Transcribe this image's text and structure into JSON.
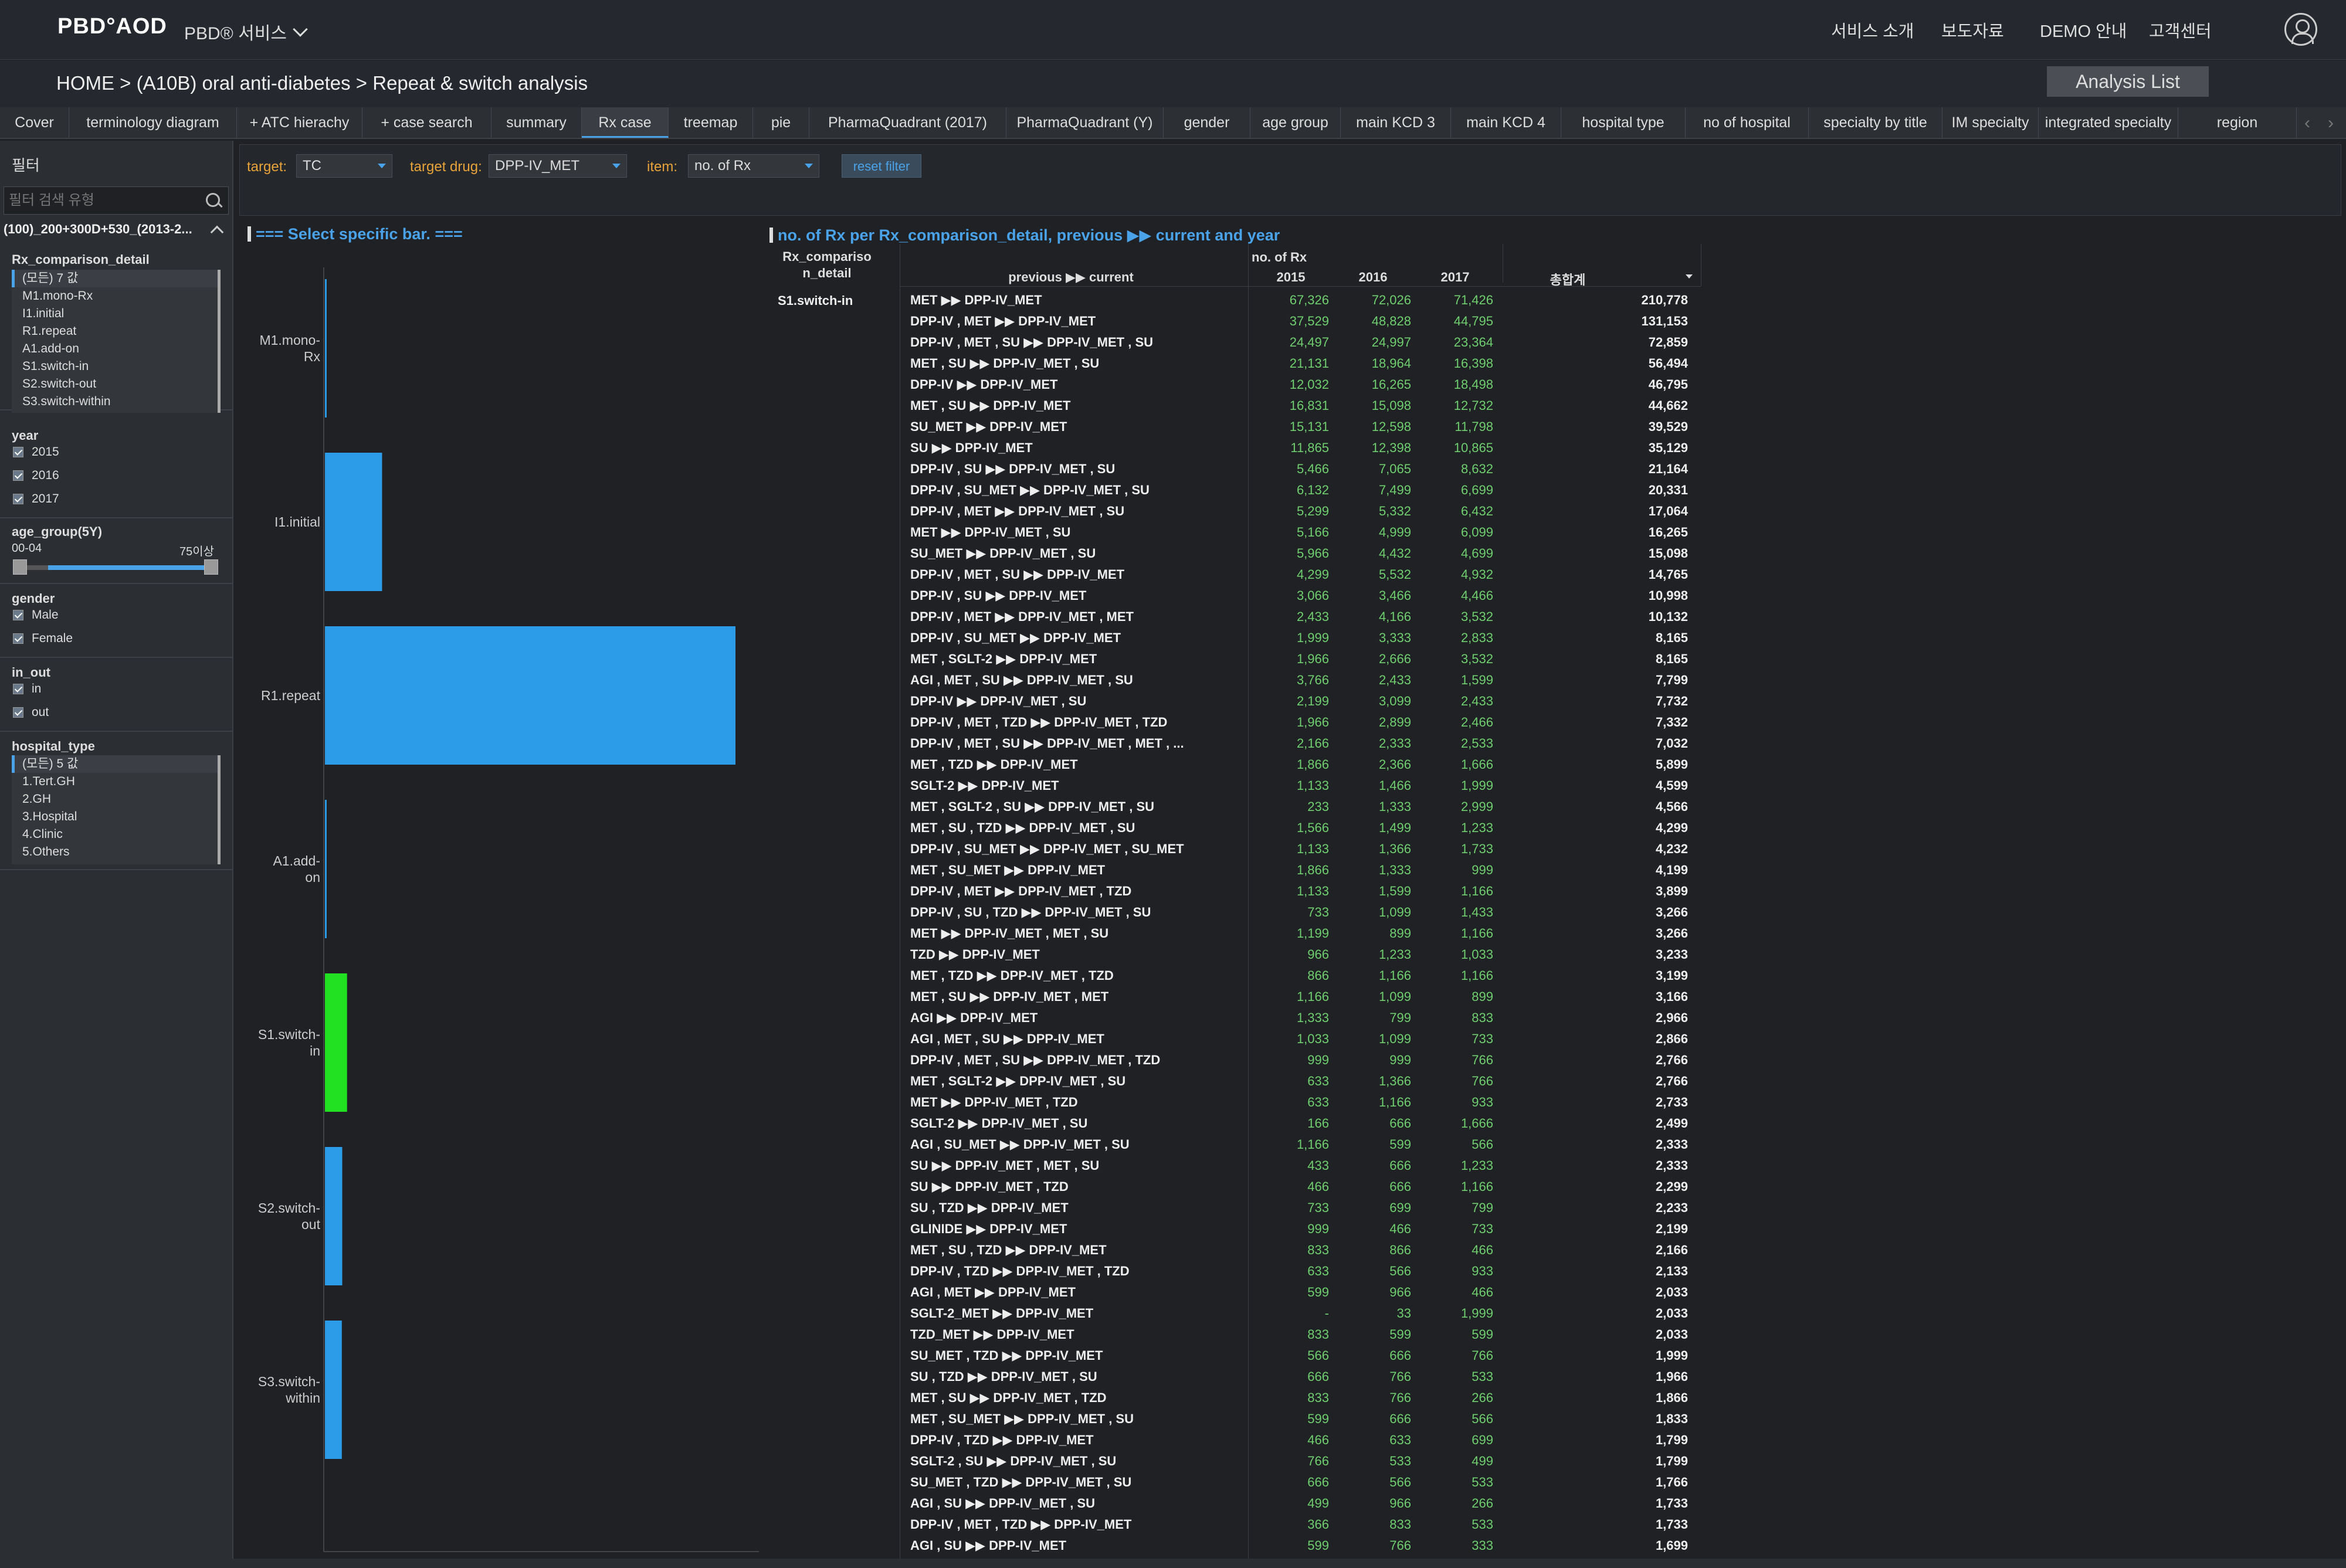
{
  "header": {
    "logo": "PBD°AOD",
    "service_menu": "PBD® 서비스",
    "nav": [
      "서비스 소개",
      "보도자료",
      "DEMO 안내",
      "고객센터"
    ],
    "user_icon": "user-icon"
  },
  "breadcrumb": {
    "text": "HOME >  (A10B) oral anti-diabetes > Repeat & switch analysis",
    "analysis_list": "Analysis List"
  },
  "tabs": [
    "Cover",
    "terminology diagram",
    "+ ATC hierachy",
    "+ case search",
    "summary",
    "Rx case",
    "treemap",
    "pie",
    "PharmaQuadrant (2017)",
    "PharmaQuadrant (Y)",
    "gender",
    "age group",
    "main KCD 3",
    "main KCD 4",
    "hospital type",
    "no of hospital",
    "specialty by title",
    "IM specialty",
    "integrated specialty",
    "region"
  ],
  "active_tab": "Rx case",
  "sidebar": {
    "title": "필터",
    "search_placeholder": "필터 검색 유형",
    "summary": "(100)_200+300D+530_(2013-2...",
    "rx_comparison": {
      "title": "Rx_comparison_detail",
      "items": [
        "(모든) 7 값",
        "M1.mono-Rx",
        "I1.initial",
        "R1.repeat",
        "A1.add-on",
        "S1.switch-in",
        "S2.switch-out",
        "S3.switch-within"
      ]
    },
    "year": {
      "title": "year",
      "items": [
        "2015",
        "2016",
        "2017"
      ]
    },
    "age_group": {
      "title": "age_group(5Y)",
      "min_label": "00-04",
      "max_label": "75이상"
    },
    "gender": {
      "title": "gender",
      "items": [
        "Male",
        "Female"
      ]
    },
    "in_out": {
      "title": "in_out",
      "items": [
        "in",
        "out"
      ]
    },
    "hospital_type": {
      "title": "hospital_type",
      "items": [
        "(모든) 5 값",
        "1.Tert.GH",
        "2.GH",
        "3.Hospital",
        "4.Clinic",
        "5.Others"
      ]
    }
  },
  "filterbar": {
    "target_label": "target:",
    "target_value": "TC",
    "drug_label": "target drug:",
    "drug_value": "DPP-IV_MET",
    "item_label": "item:",
    "item_value": "no. of Rx",
    "reset": "reset filter"
  },
  "chart_title": "=== Select specific bar. ===",
  "table_title": "no. of Rx per Rx_comparison_detail, previous ▶▶ current and year",
  "colors": {
    "accent": "#4aa3e8",
    "bar": "#2c9be8",
    "bar_selected": "#22e022",
    "value_green": "#6fcf6f",
    "label_orange": "#e8a33a"
  },
  "chart_data": {
    "type": "bar",
    "orientation": "horizontal",
    "categories": [
      "M1.mono-Rx",
      "I1.initial",
      "R1.repeat",
      "A1.add-on",
      "S1.switch-in",
      "S2.switch-out",
      "S3.switch-within"
    ],
    "values": [
      1000,
      71000,
      510000,
      500,
      27500,
      21500,
      21000
    ],
    "selected": "S1.switch-in"
  },
  "table": {
    "col_group": "Rx_compariso n_detail",
    "col_prev_curr": "previous ▶▶ current",
    "measure": "no. of Rx",
    "years": [
      "2015",
      "2016",
      "2017"
    ],
    "total_label": "총합계",
    "group_value": "S1.switch-in",
    "rows": [
      [
        "MET ▶▶ DPP-IV_MET",
        "67,326",
        "72,026",
        "71,426",
        "210,778"
      ],
      [
        "DPP-IV , MET ▶▶ DPP-IV_MET",
        "37,529",
        "48,828",
        "44,795",
        "131,153"
      ],
      [
        "DPP-IV , MET , SU ▶▶ DPP-IV_MET , SU",
        "24,497",
        "24,997",
        "23,364",
        "72,859"
      ],
      [
        "MET , SU ▶▶ DPP-IV_MET , SU",
        "21,131",
        "18,964",
        "16,398",
        "56,494"
      ],
      [
        "DPP-IV ▶▶ DPP-IV_MET",
        "12,032",
        "16,265",
        "18,498",
        "46,795"
      ],
      [
        "MET , SU ▶▶ DPP-IV_MET",
        "16,831",
        "15,098",
        "12,732",
        "44,662"
      ],
      [
        "SU_MET ▶▶ DPP-IV_MET",
        "15,131",
        "12,598",
        "11,798",
        "39,529"
      ],
      [
        "SU ▶▶ DPP-IV_MET",
        "11,865",
        "12,398",
        "10,865",
        "35,129"
      ],
      [
        "DPP-IV , SU ▶▶ DPP-IV_MET , SU",
        "5,466",
        "7,065",
        "8,632",
        "21,164"
      ],
      [
        "DPP-IV , SU_MET ▶▶ DPP-IV_MET , SU",
        "6,132",
        "7,499",
        "6,699",
        "20,331"
      ],
      [
        "DPP-IV , MET ▶▶ DPP-IV_MET , SU",
        "5,299",
        "5,332",
        "6,432",
        "17,064"
      ],
      [
        "MET ▶▶ DPP-IV_MET , SU",
        "5,166",
        "4,999",
        "6,099",
        "16,265"
      ],
      [
        "SU_MET ▶▶ DPP-IV_MET , SU",
        "5,966",
        "4,432",
        "4,699",
        "15,098"
      ],
      [
        "DPP-IV , MET , SU ▶▶ DPP-IV_MET",
        "4,299",
        "5,532",
        "4,932",
        "14,765"
      ],
      [
        "DPP-IV , SU ▶▶ DPP-IV_MET",
        "3,066",
        "3,466",
        "4,466",
        "10,998"
      ],
      [
        "DPP-IV , MET ▶▶ DPP-IV_MET , MET",
        "2,433",
        "4,166",
        "3,532",
        "10,132"
      ],
      [
        "DPP-IV , SU_MET ▶▶ DPP-IV_MET",
        "1,999",
        "3,333",
        "2,833",
        "8,165"
      ],
      [
        "MET , SGLT-2 ▶▶ DPP-IV_MET",
        "1,966",
        "2,666",
        "3,532",
        "8,165"
      ],
      [
        "AGI , MET , SU ▶▶ DPP-IV_MET , SU",
        "3,766",
        "2,433",
        "1,599",
        "7,799"
      ],
      [
        "DPP-IV ▶▶ DPP-IV_MET , SU",
        "2,199",
        "3,099",
        "2,433",
        "7,732"
      ],
      [
        "DPP-IV , MET , TZD ▶▶ DPP-IV_MET , TZD",
        "1,966",
        "2,899",
        "2,466",
        "7,332"
      ],
      [
        "DPP-IV , MET , SU ▶▶ DPP-IV_MET , MET , ...",
        "2,166",
        "2,333",
        "2,533",
        "7,032"
      ],
      [
        "MET , TZD ▶▶ DPP-IV_MET",
        "1,866",
        "2,366",
        "1,666",
        "5,899"
      ],
      [
        "SGLT-2 ▶▶ DPP-IV_MET",
        "1,133",
        "1,466",
        "1,999",
        "4,599"
      ],
      [
        "MET , SGLT-2 , SU ▶▶ DPP-IV_MET , SU",
        "233",
        "1,333",
        "2,999",
        "4,566"
      ],
      [
        "MET , SU , TZD ▶▶ DPP-IV_MET , SU",
        "1,566",
        "1,499",
        "1,233",
        "4,299"
      ],
      [
        "DPP-IV , SU_MET ▶▶ DPP-IV_MET , SU_MET",
        "1,133",
        "1,366",
        "1,733",
        "4,232"
      ],
      [
        "MET , SU_MET ▶▶ DPP-IV_MET",
        "1,866",
        "1,333",
        "999",
        "4,199"
      ],
      [
        "DPP-IV , MET ▶▶ DPP-IV_MET , TZD",
        "1,133",
        "1,599",
        "1,166",
        "3,899"
      ],
      [
        "DPP-IV , SU , TZD ▶▶ DPP-IV_MET , SU",
        "733",
        "1,099",
        "1,433",
        "3,266"
      ],
      [
        "MET ▶▶ DPP-IV_MET , MET , SU",
        "1,199",
        "899",
        "1,166",
        "3,266"
      ],
      [
        "TZD ▶▶ DPP-IV_MET",
        "966",
        "1,233",
        "1,033",
        "3,233"
      ],
      [
        "MET , TZD ▶▶ DPP-IV_MET , TZD",
        "866",
        "1,166",
        "1,166",
        "3,199"
      ],
      [
        "MET , SU ▶▶ DPP-IV_MET , MET",
        "1,166",
        "1,099",
        "899",
        "3,166"
      ],
      [
        "AGI ▶▶ DPP-IV_MET",
        "1,333",
        "799",
        "833",
        "2,966"
      ],
      [
        "AGI , MET , SU ▶▶ DPP-IV_MET",
        "1,033",
        "1,099",
        "733",
        "2,866"
      ],
      [
        "DPP-IV , MET , SU ▶▶ DPP-IV_MET , TZD",
        "999",
        "999",
        "766",
        "2,766"
      ],
      [
        "MET , SGLT-2 ▶▶ DPP-IV_MET , SU",
        "633",
        "1,366",
        "766",
        "2,766"
      ],
      [
        "MET ▶▶ DPP-IV_MET , TZD",
        "633",
        "1,166",
        "933",
        "2,733"
      ],
      [
        "SGLT-2 ▶▶ DPP-IV_MET , SU",
        "166",
        "666",
        "1,666",
        "2,499"
      ],
      [
        "AGI , SU_MET ▶▶ DPP-IV_MET , SU",
        "1,166",
        "599",
        "566",
        "2,333"
      ],
      [
        "SU ▶▶ DPP-IV_MET , MET , SU",
        "433",
        "666",
        "1,233",
        "2,333"
      ],
      [
        "SU ▶▶ DPP-IV_MET , TZD",
        "466",
        "666",
        "1,166",
        "2,299"
      ],
      [
        "SU , TZD ▶▶ DPP-IV_MET",
        "733",
        "699",
        "799",
        "2,233"
      ],
      [
        "GLINIDE ▶▶ DPP-IV_MET",
        "999",
        "466",
        "733",
        "2,199"
      ],
      [
        "MET , SU , TZD ▶▶ DPP-IV_MET",
        "833",
        "866",
        "466",
        "2,166"
      ],
      [
        "DPP-IV , TZD ▶▶ DPP-IV_MET , TZD",
        "633",
        "566",
        "933",
        "2,133"
      ],
      [
        "AGI , MET ▶▶ DPP-IV_MET",
        "599",
        "966",
        "466",
        "2,033"
      ],
      [
        "SGLT-2_MET ▶▶ DPP-IV_MET",
        "-",
        "33",
        "1,999",
        "2,033"
      ],
      [
        "TZD_MET ▶▶ DPP-IV_MET",
        "833",
        "599",
        "599",
        "2,033"
      ],
      [
        "SU_MET , TZD ▶▶ DPP-IV_MET",
        "566",
        "666",
        "766",
        "1,999"
      ],
      [
        "SU , TZD ▶▶ DPP-IV_MET , SU",
        "666",
        "766",
        "533",
        "1,966"
      ],
      [
        "MET , SU ▶▶ DPP-IV_MET , TZD",
        "833",
        "766",
        "266",
        "1,866"
      ],
      [
        "MET , SU_MET ▶▶ DPP-IV_MET , SU",
        "599",
        "666",
        "566",
        "1,833"
      ],
      [
        "DPP-IV , TZD ▶▶ DPP-IV_MET",
        "466",
        "633",
        "699",
        "1,799"
      ],
      [
        "SGLT-2 , SU ▶▶ DPP-IV_MET , SU",
        "766",
        "533",
        "499",
        "1,799"
      ],
      [
        "SU_MET , TZD ▶▶ DPP-IV_MET , SU",
        "666",
        "566",
        "533",
        "1,766"
      ],
      [
        "AGI , SU ▶▶ DPP-IV_MET , SU",
        "499",
        "966",
        "266",
        "1,733"
      ],
      [
        "DPP-IV , MET , TZD ▶▶ DPP-IV_MET",
        "366",
        "833",
        "533",
        "1,733"
      ],
      [
        "AGI , SU ▶▶ DPP-IV_MET",
        "599",
        "766",
        "333",
        "1,699"
      ]
    ]
  }
}
